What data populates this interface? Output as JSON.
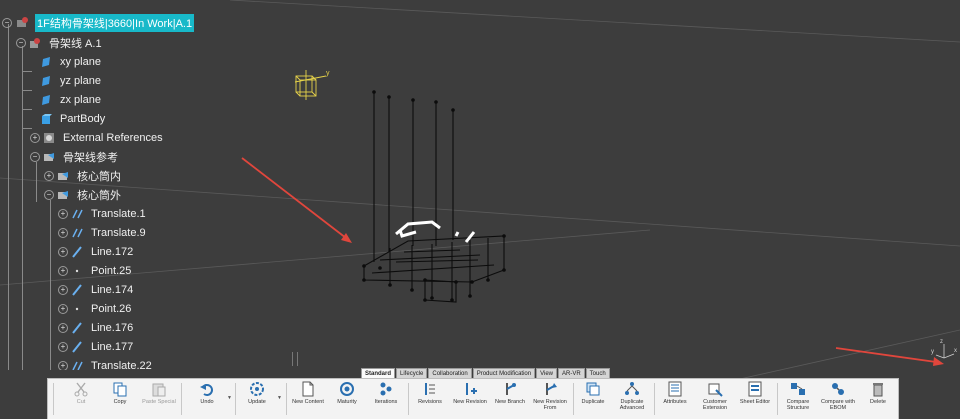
{
  "tree": {
    "root_label": "1F结构骨架线|3660|In Work|A.1",
    "items": [
      {
        "label": "骨架线 A.1"
      },
      {
        "label": "xy plane"
      },
      {
        "label": "yz plane"
      },
      {
        "label": "zx plane"
      },
      {
        "label": "PartBody"
      },
      {
        "label": "External References"
      },
      {
        "label": "骨架线参考"
      },
      {
        "label": "核心筒内"
      },
      {
        "label": "核心筒外"
      },
      {
        "label": "Translate.1"
      },
      {
        "label": "Translate.9"
      },
      {
        "label": "Line.172"
      },
      {
        "label": "Point.25"
      },
      {
        "label": "Line.174"
      },
      {
        "label": "Point.26"
      },
      {
        "label": "Line.176"
      },
      {
        "label": "Line.177"
      },
      {
        "label": "Translate.22"
      }
    ]
  },
  "axis": {
    "y": "y",
    "x": "x",
    "z": "z"
  },
  "tabs": [
    "Standard",
    "Lifecycle",
    "Collaboration",
    "Product Modification",
    "View",
    "AR-VR",
    "Touch"
  ],
  "commands": [
    {
      "label": "Cut",
      "icon": "cut-icon",
      "disabled": true
    },
    {
      "label": "Copy",
      "icon": "copy-icon",
      "disabled": false
    },
    {
      "label": "Paste Special",
      "icon": "paste-icon",
      "disabled": true
    },
    {
      "label": "Undo",
      "icon": "undo-icon",
      "disabled": false
    },
    {
      "label": "Update",
      "icon": "update-icon",
      "disabled": false
    },
    {
      "label": "New Content",
      "icon": "new-content-icon",
      "disabled": false
    },
    {
      "label": "Maturity",
      "icon": "maturity-icon",
      "disabled": false
    },
    {
      "label": "Iterations",
      "icon": "iterations-icon",
      "disabled": false
    },
    {
      "label": "Revisions",
      "icon": "revisions-icon",
      "disabled": false
    },
    {
      "label": "New Revision",
      "icon": "new-revision-icon",
      "disabled": false
    },
    {
      "label": "New Branch",
      "icon": "new-branch-icon",
      "disabled": false
    },
    {
      "label": "New Revision From",
      "icon": "new-revision-from-icon",
      "disabled": false
    },
    {
      "label": "Duplicate",
      "icon": "duplicate-icon",
      "disabled": false
    },
    {
      "label": "Duplicate Advanced",
      "icon": "duplicate-advanced-icon",
      "disabled": false
    },
    {
      "label": "Attributes",
      "icon": "attributes-icon",
      "disabled": false
    },
    {
      "label": "Customer Extension",
      "icon": "customer-extension-icon",
      "disabled": false
    },
    {
      "label": "Sheet Editor",
      "icon": "sheet-editor-icon",
      "disabled": false
    },
    {
      "label": "Compare Structure",
      "icon": "compare-structure-icon",
      "disabled": false
    },
    {
      "label": "Compare with EBOM",
      "icon": "compare-ebom-icon",
      "disabled": false
    },
    {
      "label": "Delete",
      "icon": "delete-icon",
      "disabled": false
    }
  ],
  "colors": {
    "background": "#3d3d3d",
    "selection": "#18b9c9",
    "annotation_arrow": "#e0463c"
  }
}
